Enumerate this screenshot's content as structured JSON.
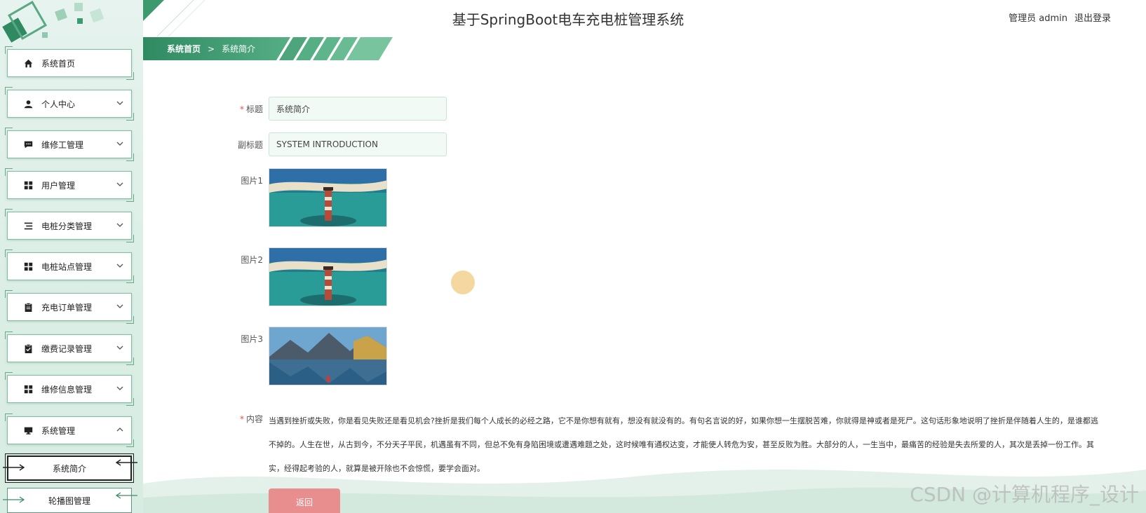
{
  "header": {
    "title": "基于SpringBoot电车充电桩管理系统",
    "user_label": "管理员 admin",
    "logout_label": "退出登录"
  },
  "breadcrumb": {
    "home": "系统首页",
    "separator": ">",
    "current": "系统简介"
  },
  "sidebar": {
    "items": [
      {
        "label": "系统首页",
        "icon": "home-icon"
      },
      {
        "label": "个人中心",
        "icon": "user-icon"
      },
      {
        "label": "维修工管理",
        "icon": "chat-icon"
      },
      {
        "label": "用户管理",
        "icon": "grid-icon"
      },
      {
        "label": "电桩分类管理",
        "icon": "list-icon"
      },
      {
        "label": "电桩站点管理",
        "icon": "grid-icon"
      },
      {
        "label": "充电订单管理",
        "icon": "clipboard-icon"
      },
      {
        "label": "缴费记录管理",
        "icon": "clipboard-check-icon"
      },
      {
        "label": "维修信息管理",
        "icon": "grid-icon"
      },
      {
        "label": "系统管理",
        "icon": "monitor-icon"
      }
    ],
    "subitems": [
      {
        "label": "系统简介",
        "active": true
      },
      {
        "label": "轮播图管理",
        "active": false
      }
    ]
  },
  "form": {
    "title_label": "标题",
    "title_value": "系统简介",
    "subtitle_label": "副标题",
    "subtitle_value": "SYSTEM INTRODUCTION",
    "pic1_label": "图片1",
    "pic2_label": "图片2",
    "pic3_label": "图片3",
    "content_label": "内容",
    "content_value": "当遇到挫折或失败，你是看见失败还是看见机会?挫折是我们每个人成长的必经之路，它不是你想有就有，想没有就没有的。有句名言说的好，如果你想一生摆脱苦难，你就得是神或者是死尸。这句话形象地说明了挫折是伴随着人生的，是谁都逃不掉的。人生在世，从古到今，不分天子平民，机遇虽有不同，但总不免有身陷困境或遭遇难题之处，这时候唯有通权达变，才能使人转危为安，甚至反败为胜。大部分的人，一生当中，最痛苦的经验是失去所爱的人，其次是丢掉一份工作。其实，经得起考验的人，就算是被开除也不会惊慌，要学会面对。",
    "back_label": "返回"
  },
  "watermark": "CSDN @计算机程序_设计",
  "colors": {
    "accent": "#3d9a6e",
    "accent_dark": "#2f7d58",
    "required": "#e05050",
    "back_button": "#e98e8e"
  }
}
